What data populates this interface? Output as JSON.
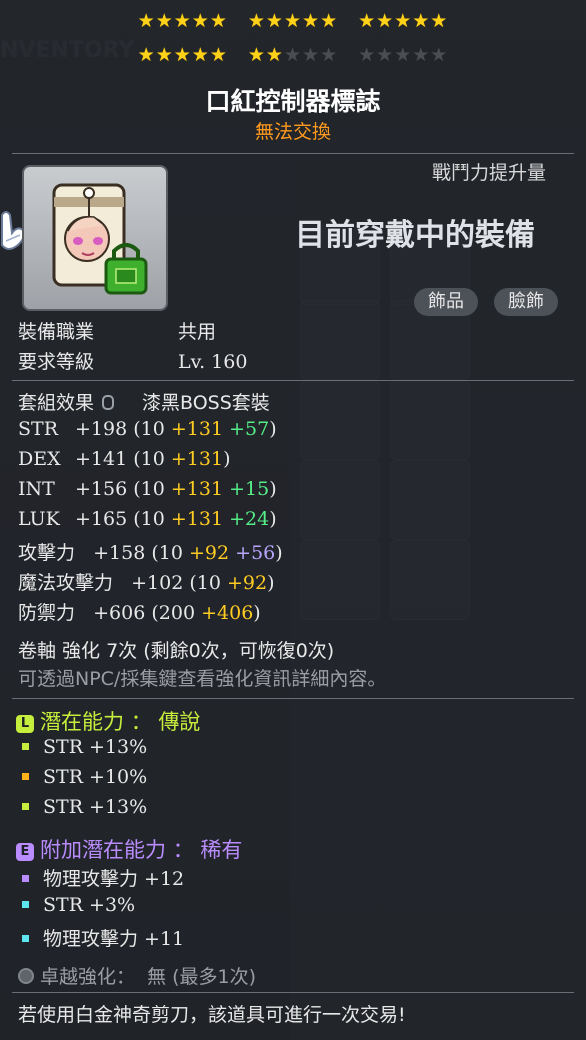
{
  "colors": {
    "star_on": "#ffd21a",
    "star_off": "#4a4d52",
    "trade_text": "#ff9a1e",
    "bonus_yellow": "#ffcc22",
    "bonus_green": "#55ee88",
    "bonus_purple": "#b8a6ff",
    "legendary": "#c6ee3c",
    "rare": "#b98cff"
  },
  "stars": {
    "total": 30,
    "filled": 22
  },
  "item": {
    "name": "口紅控制器標誌",
    "trade_status": "無法交換"
  },
  "compare": {
    "title": "戰鬥力提升量",
    "heading": "目前穿戴中的裝備",
    "tags": [
      "飾品",
      "臉飾"
    ]
  },
  "req": {
    "job_label": "裝備職業",
    "job_value": "共用",
    "level_label": "要求等級",
    "level_value": "Lv. 160"
  },
  "set": {
    "label": "套組效果",
    "value": "漆黑BOSS套裝"
  },
  "stats": [
    {
      "name": "STR",
      "total": "+198",
      "base": "(10",
      "bonus1": "+131",
      "bonus2": "+57",
      "close": ")"
    },
    {
      "name": "DEX",
      "total": "+141",
      "base": "(10",
      "bonus1": "+131",
      "bonus2": "",
      "close": ")"
    },
    {
      "name": "INT",
      "total": "+156",
      "base": "(10",
      "bonus1": "+131",
      "bonus2": "+15",
      "close": ")"
    },
    {
      "name": "LUK",
      "total": "+165",
      "base": "(10",
      "bonus1": "+131",
      "bonus2": "+24",
      "close": ")"
    }
  ],
  "attack": {
    "label": "攻擊力",
    "total": "+158",
    "base": "(10",
    "bonus1": "+92",
    "bonus2": "+56",
    "close": ")"
  },
  "magic": {
    "label": "魔法攻擊力",
    "total": "+102",
    "base": "(10",
    "bonus1": "+92",
    "close": ")"
  },
  "defense": {
    "label": "防禦力",
    "total": "+606",
    "base": "(200",
    "bonus1": "+406",
    "close": ")"
  },
  "scroll": {
    "text": "卷軸 強化 7次 (剩餘0次，可恢復0次)",
    "hint": "可透過NPC/採集鍵查看強化資訊詳細內容。"
  },
  "potential": {
    "badge": "L",
    "label": "潛在能力",
    "sep": "：",
    "grade": "傳說",
    "lines": [
      {
        "text": "STR +13%",
        "bullet_color": "#c6ee3c"
      },
      {
        "text": "STR +10%",
        "bullet_color": "#ffb21a"
      },
      {
        "text": "STR +13%",
        "bullet_color": "#c6ee3c"
      }
    ]
  },
  "additional": {
    "badge": "E",
    "label": "附加潛在能力",
    "sep": "：",
    "grade": "稀有",
    "lines": [
      {
        "text": "物理攻擊力 +12",
        "bullet_color": "#b98cff"
      },
      {
        "text": "STR +3%",
        "bullet_color": "#5ee6f0"
      },
      {
        "text": "物理攻擊力 +11",
        "bullet_color": "#5ee6f0"
      }
    ]
  },
  "exceptional": {
    "label": "卓越強化：",
    "value": "無 (最多1次)"
  },
  "footer": "若使用白金神奇剪刀，該道具可進行一次交易!"
}
